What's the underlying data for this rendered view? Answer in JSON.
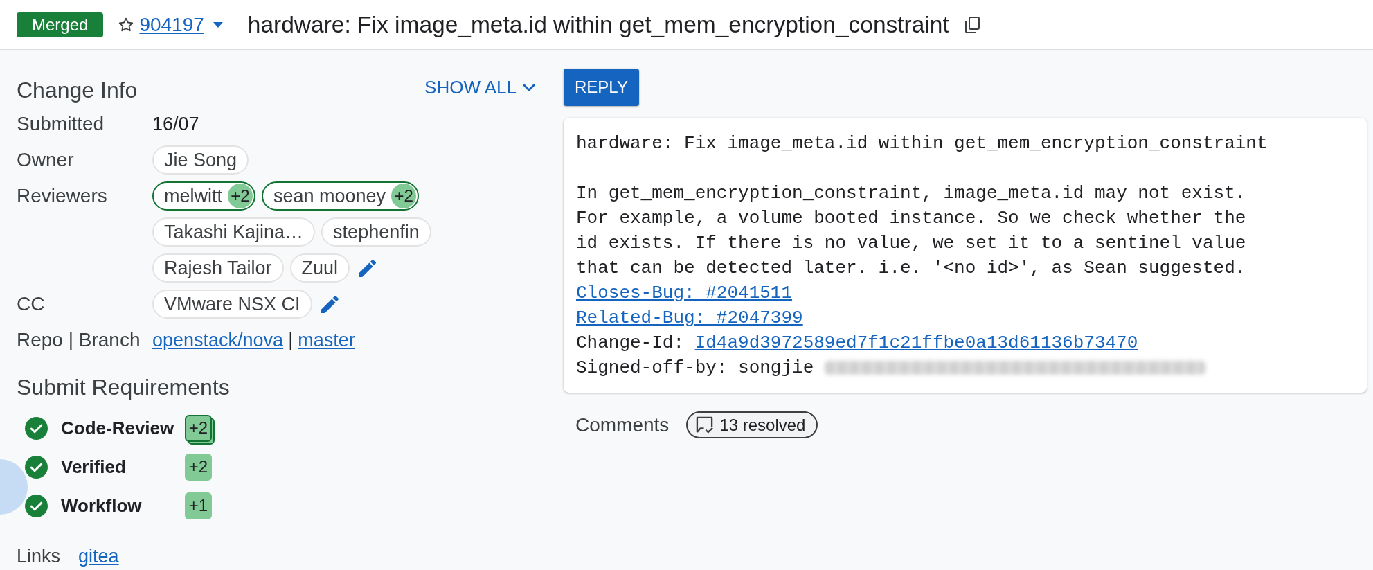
{
  "header": {
    "status": "Merged",
    "starred": false,
    "change_number": "904197",
    "title": "hardware: Fix image_meta.id within get_mem_encryption_constraint"
  },
  "change_info": {
    "title": "Change Info",
    "show_all": "SHOW ALL",
    "rows": [
      {
        "label": "Submitted",
        "kind": "text",
        "editable": false,
        "value": "16/07"
      },
      {
        "label": "Owner",
        "kind": "people",
        "editable": false,
        "people": [
          {
            "name": "Jie Song"
          }
        ]
      },
      {
        "label": "Reviewers",
        "kind": "people",
        "editable": true,
        "people": [
          {
            "name": "melwitt",
            "vote": "+2"
          },
          {
            "name": "sean mooney",
            "vote": "+2"
          },
          {
            "name": "Takashi Kajina…"
          },
          {
            "name": "stephenfin"
          },
          {
            "name": "Rajesh Tailor"
          },
          {
            "name": "Zuul"
          }
        ]
      },
      {
        "label": "CC",
        "kind": "people",
        "editable": true,
        "people": [
          {
            "name": "VMware NSX CI"
          }
        ]
      },
      {
        "label": "Repo | Branch",
        "kind": "links",
        "editable": false,
        "links": [
          "openstack/nova",
          "master"
        ],
        "separator": "|"
      }
    ]
  },
  "submit_requirements": {
    "title": "Submit Requirements",
    "items": [
      {
        "name": "Code-Review",
        "satisfied": true,
        "vote": "+2",
        "multiple": true
      },
      {
        "name": "Verified",
        "satisfied": true,
        "vote": "+2",
        "multiple": false
      },
      {
        "name": "Workflow",
        "satisfied": true,
        "vote": "+1",
        "multiple": false
      }
    ]
  },
  "links": {
    "label": "Links",
    "items": [
      "gitea"
    ]
  },
  "reply_button": "REPLY",
  "commit_message": {
    "lines": [
      {
        "kind": "text",
        "text": "hardware: Fix image_meta.id within get_mem_encryption_constraint"
      },
      {
        "kind": "blank"
      },
      {
        "kind": "paragraph",
        "lines": [
          "In get_mem_encryption_constraint, image_meta.id may not exist.",
          "For example, a volume booted instance. So we check whether the",
          "id exists. If there is no value, we set it to a sentinel value",
          "that can be detected later. i.e. '<no id>', as Sean suggested."
        ]
      },
      {
        "kind": "link",
        "text": "Closes-Bug: #2041511"
      },
      {
        "kind": "link",
        "text": "Related-Bug: #2047399"
      },
      {
        "kind": "footer",
        "text": "Change-Id:",
        "link": "Id4a9d3972589ed7f1c21ffbe0a13d61136b73470",
        "blurred": false
      },
      {
        "kind": "footer",
        "text": "Signed-off-by: songjie",
        "blurred": true
      }
    ]
  },
  "comments": {
    "label": "Comments",
    "summary": "13 resolved"
  }
}
